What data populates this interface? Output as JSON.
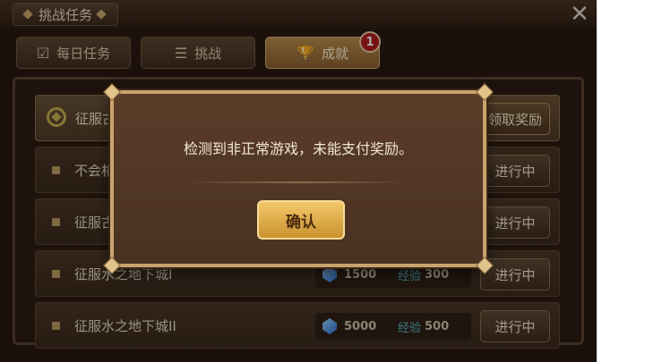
{
  "header": {
    "title": "挑战任务",
    "close_icon": "close-icon"
  },
  "tabs": [
    {
      "label": "每日任务",
      "icon": "check-circle-icon"
    },
    {
      "label": "挑战",
      "icon": "list-icon"
    },
    {
      "label": "成就",
      "icon": "trophy-icon",
      "badge": "1",
      "active": true
    }
  ],
  "rows": [
    {
      "name": "征服古",
      "button": "领取奖励"
    },
    {
      "name": "不会相",
      "button": "进行中"
    },
    {
      "name": "征服古",
      "button": "进行中"
    },
    {
      "name": "征服水之地下城I",
      "gems": "1500",
      "exp_label": "经验",
      "exp": "300",
      "button": "进行中"
    },
    {
      "name": "征服水之地下城II",
      "gems": "5000",
      "exp_label": "经验",
      "exp": "500",
      "button": "进行中"
    }
  ],
  "dialog": {
    "message": "检测到非正常游戏，未能支付奖励。",
    "confirm": "确认"
  },
  "colors": {
    "accent_gold": "#c8a46c",
    "badge_red": "#b01d1d",
    "exp_teal": "#5ab3c0"
  }
}
